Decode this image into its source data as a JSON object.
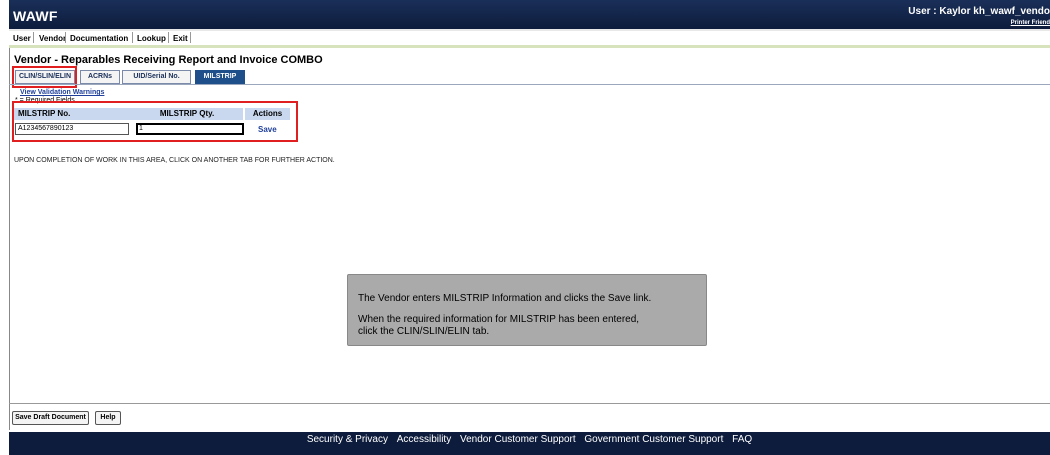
{
  "app": {
    "logo": "WAWF",
    "user_text": "User : Kaylor kh_wawf_vendo",
    "printer_friendly": "Printer Friend"
  },
  "menu": [
    "User",
    "Vendor",
    "Documentation",
    "Lookup",
    "Exit"
  ],
  "page": {
    "title": "Vendor - Reparables Receiving Report and Invoice COMBO"
  },
  "tabs": [
    {
      "label": "CLIN/SLIN/ELIN",
      "active": false
    },
    {
      "label": "ACRNs",
      "active": false
    },
    {
      "label": "UID/Serial No.",
      "active": false
    },
    {
      "label": "MILSTRIP",
      "active": true
    }
  ],
  "form": {
    "view_warnings": "View Validation Warnings",
    "required_note": "* = Required Fields",
    "headers": {
      "milstrip_no": "MILSTRIP No.",
      "milstrip_qty": "MILSTRIP Qty.",
      "actions": "Actions"
    },
    "milstrip_no_value": "A1234567890123",
    "milstrip_qty_value": "1",
    "save_link": "Save"
  },
  "instruction": "UPON COMPLETION OF WORK IN THIS AREA, CLICK ON ANOTHER TAB FOR FURTHER ACTION.",
  "callout": {
    "line1": "The Vendor enters MILSTRIP Information and clicks the Save link.",
    "line2": "When the required information for MILSTRIP has been entered,",
    "line3": "click the CLIN/SLIN/ELIN tab."
  },
  "buttons": {
    "save_draft": "Save Draft Document",
    "help": "Help"
  },
  "footer": [
    "Security & Privacy",
    "Accessibility",
    "Vendor Customer Support",
    "Government Customer Support",
    "FAQ"
  ]
}
